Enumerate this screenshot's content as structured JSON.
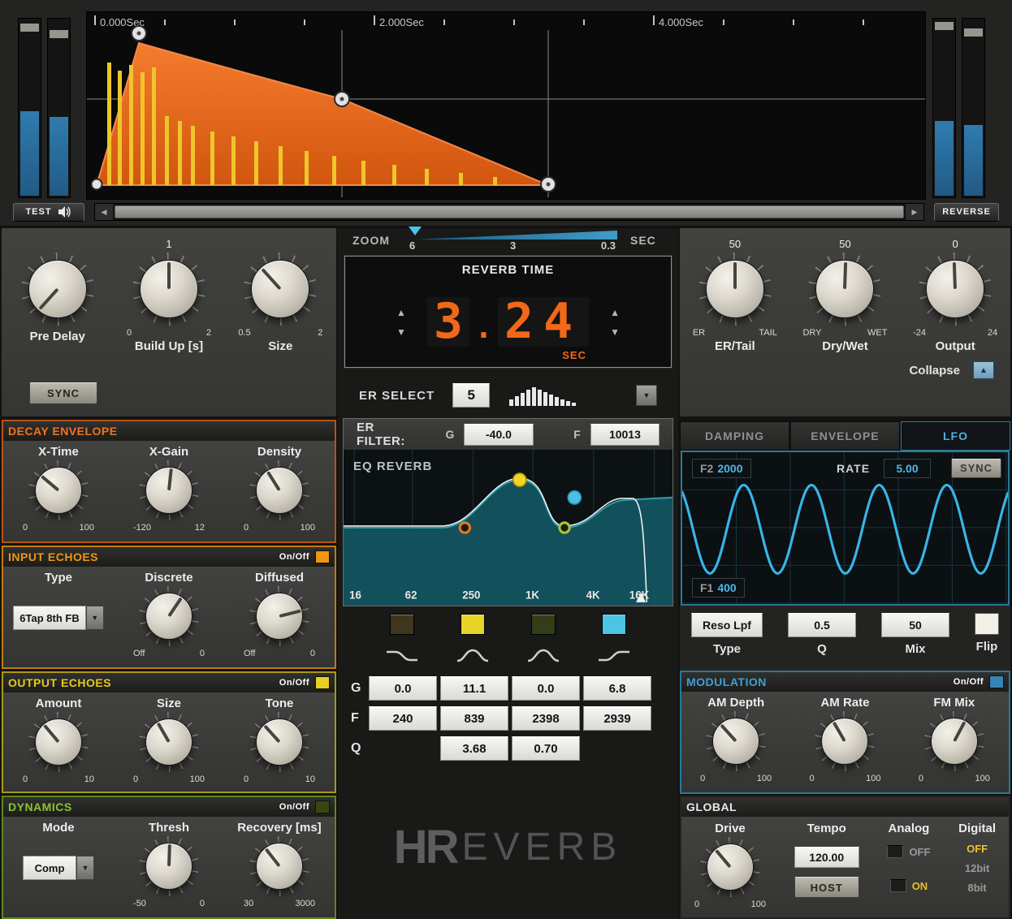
{
  "accents": {
    "envelope_orange": "#e8611c",
    "bars_yellow": "#eec62a",
    "wave_cyan": "#3ab4e6",
    "decay": "#b4551a",
    "input_echoes": "#c07b12",
    "output_echoes": "#a89a14",
    "dynamics": "#5d8a1e",
    "modulation": "#2a7898",
    "digits_orange": "#f26818",
    "lfo_value_blue": "#4db8e8"
  },
  "icons": {
    "dropdown": "▼",
    "up_arrow": "▲",
    "spin_up": "▲",
    "spin_down": "▼",
    "scroll_left": "◀",
    "scroll_right": "▶"
  },
  "waveform": {
    "time_labels": [
      "0.000Sec",
      "2.000Sec",
      "4.000Sec"
    ],
    "test_button": "TEST",
    "reverse_button": "REVERSE"
  },
  "zoom": {
    "label": "ZOOM",
    "ticks": [
      "6",
      "3",
      "0.3"
    ],
    "unit": "SEC"
  },
  "left": {
    "top": {
      "predelay_label": "Pre Delay",
      "sync_button": "SYNC",
      "buildup_top": "1",
      "buildup_min": "0",
      "buildup_max": "2",
      "buildup_label": "Build Up [s]",
      "size_min": "0.5",
      "size_max": "2",
      "size_label": "Size"
    },
    "decay": {
      "title": "DECAY ENVELOPE",
      "knobs": [
        {
          "label": "X-Time",
          "min": "0",
          "max": "100"
        },
        {
          "label": "X-Gain",
          "min": "-120",
          "max": "12"
        },
        {
          "label": "Density",
          "min": "0",
          "max": "100"
        }
      ]
    },
    "input_echoes": {
      "title": "INPUT ECHOES",
      "onoff": "On/Off",
      "type_label": "Type",
      "type_value": "6Tap 8th FB",
      "knobs": [
        {
          "label": "Discrete",
          "min": "Off",
          "max": "0"
        },
        {
          "label": "Diffused",
          "min": "Off",
          "max": "0"
        }
      ]
    },
    "output_echoes": {
      "title": "OUTPUT ECHOES",
      "onoff": "On/Off",
      "knobs": [
        {
          "label": "Amount",
          "min": "0",
          "max": "10"
        },
        {
          "label": "Size",
          "min": "0",
          "max": "100"
        },
        {
          "label": "Tone",
          "min": "0",
          "max": "10"
        }
      ]
    },
    "dynamics": {
      "title": "DYNAMICS",
      "onoff": "On/Off",
      "mode_label": "Mode",
      "mode_value": "Comp",
      "knobs": [
        {
          "label": "Thresh",
          "min": "-50",
          "max": "0"
        },
        {
          "label": "Recovery [ms]",
          "min": "30",
          "max": "3000"
        }
      ]
    }
  },
  "center": {
    "reverb_time": {
      "title": "REVERB TIME",
      "int": "3",
      "dot": ".",
      "frac": "24",
      "unit": "SEC"
    },
    "er_select": {
      "label": "ER SELECT",
      "value": "5"
    },
    "er_filter": {
      "label": "ER FILTER:",
      "g_label": "G",
      "g_value": "-40.0",
      "f_label": "F",
      "f_value": "10013"
    },
    "eq": {
      "title": "EQ REVERB",
      "freq_labels": [
        "16",
        "62",
        "250",
        "1K",
        "4K",
        "16K"
      ],
      "band_colors": [
        "#40351d",
        "#e8d428",
        "#333d18",
        "#4cc4e4"
      ],
      "g_label": "G",
      "f_label": "F",
      "q_label": "Q",
      "g_values": [
        "0.0",
        "11.1",
        "0.0",
        "6.8"
      ],
      "f_values": [
        "240",
        "839",
        "2398",
        "2939"
      ],
      "q_values": [
        "3.68",
        "0.70"
      ]
    },
    "logo": {
      "h": "H",
      "r": "R",
      "rest": "EVERB"
    }
  },
  "right": {
    "top": {
      "knobs": [
        {
          "top": "50",
          "min": "ER",
          "max": "TAIL",
          "label": "ER/Tail"
        },
        {
          "top": "50",
          "min": "DRY",
          "max": "WET",
          "label": "Dry/Wet"
        },
        {
          "top": "0",
          "min": "-24",
          "max": "24",
          "label": "Output"
        }
      ],
      "collapse_label": "Collapse"
    },
    "tabs": [
      "DAMPING",
      "ENVELOPE",
      "LFO"
    ],
    "lfo": {
      "f2_label": "F2",
      "f2_value": "2000",
      "rate_label": "RATE",
      "rate_value": "5.00",
      "sync_button": "SYNC",
      "f1_label": "F1",
      "f1_value": "400"
    },
    "filter": {
      "type_value": "Reso Lpf",
      "type_label": "Type",
      "q_value": "0.5",
      "q_label": "Q",
      "mix_value": "50",
      "mix_label": "Mix",
      "flip_label": "Flip"
    },
    "modulation": {
      "title": "MODULATION",
      "onoff": "On/Off",
      "knobs": [
        {
          "label": "AM Depth",
          "min": "0",
          "max": "100"
        },
        {
          "label": "AM Rate",
          "min": "0",
          "max": "100"
        },
        {
          "label": "FM Mix",
          "min": "0",
          "max": "100"
        }
      ]
    },
    "global": {
      "title": "GLOBAL",
      "drive": {
        "label": "Drive",
        "min": "0",
        "max": "100"
      },
      "tempo_label": "Tempo",
      "tempo_value": "120.00",
      "host_button": "HOST",
      "analog_label": "Analog",
      "analog_off": "OFF",
      "analog_on": "ON",
      "digital_label": "Digital",
      "digital_options": [
        "OFF",
        "12bit",
        "8bit"
      ]
    }
  }
}
